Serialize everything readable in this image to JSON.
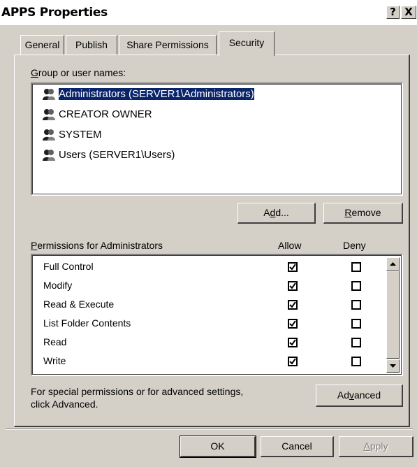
{
  "window": {
    "title": "APPS Properties",
    "help_label": "?",
    "close_label": "X"
  },
  "tabs": [
    {
      "label": "General",
      "active": false
    },
    {
      "label": "Publish",
      "active": false
    },
    {
      "label": "Share Permissions",
      "active": false
    },
    {
      "label": "Security",
      "active": true
    }
  ],
  "security": {
    "group_label_prefix": "",
    "group_label_hotkey": "G",
    "group_label_rest": "roup or user names:",
    "users": [
      {
        "label": "Administrators (SERVER1\\Administrators)",
        "selected": true
      },
      {
        "label": "CREATOR OWNER",
        "selected": false
      },
      {
        "label": "SYSTEM",
        "selected": false
      },
      {
        "label": "Users (SERVER1\\Users)",
        "selected": false
      }
    ],
    "add_button": {
      "pre": "A",
      "hotkey": "d",
      "post": "d..."
    },
    "remove_button": {
      "pre": "",
      "hotkey": "R",
      "post": "emove"
    },
    "permissions_label_hotkey": "P",
    "permissions_label_rest": "ermissions for Administrators",
    "allow_header": "Allow",
    "deny_header": "Deny",
    "permissions": [
      {
        "name": "Full Control",
        "allow": true,
        "deny": false
      },
      {
        "name": "Modify",
        "allow": true,
        "deny": false
      },
      {
        "name": "Read & Execute",
        "allow": true,
        "deny": false
      },
      {
        "name": "List Folder Contents",
        "allow": true,
        "deny": false
      },
      {
        "name": "Read",
        "allow": true,
        "deny": false
      },
      {
        "name": "Write",
        "allow": true,
        "deny": false
      }
    ],
    "advanced_text_line1": "For special permissions or for advanced settings,",
    "advanced_text_line2": "click Advanced.",
    "advanced_button": {
      "pre": "Ad",
      "hotkey": "v",
      "post": "anced"
    }
  },
  "footer": {
    "ok_label": "OK",
    "cancel_label": "Cancel",
    "apply_pre": "",
    "apply_hotkey": "A",
    "apply_post": "pply"
  },
  "icons": {
    "help": "help-icon",
    "close": "close-icon",
    "user_group": "user-group-icon",
    "scroll_up": "scroll-up-arrow-icon",
    "scroll_down": "scroll-down-arrow-icon",
    "checkmark": "checkmark-icon"
  },
  "colors": {
    "dialog_bg": "#d4d0c8",
    "selection_bg": "#0a246a",
    "selection_fg": "#ffffff"
  }
}
